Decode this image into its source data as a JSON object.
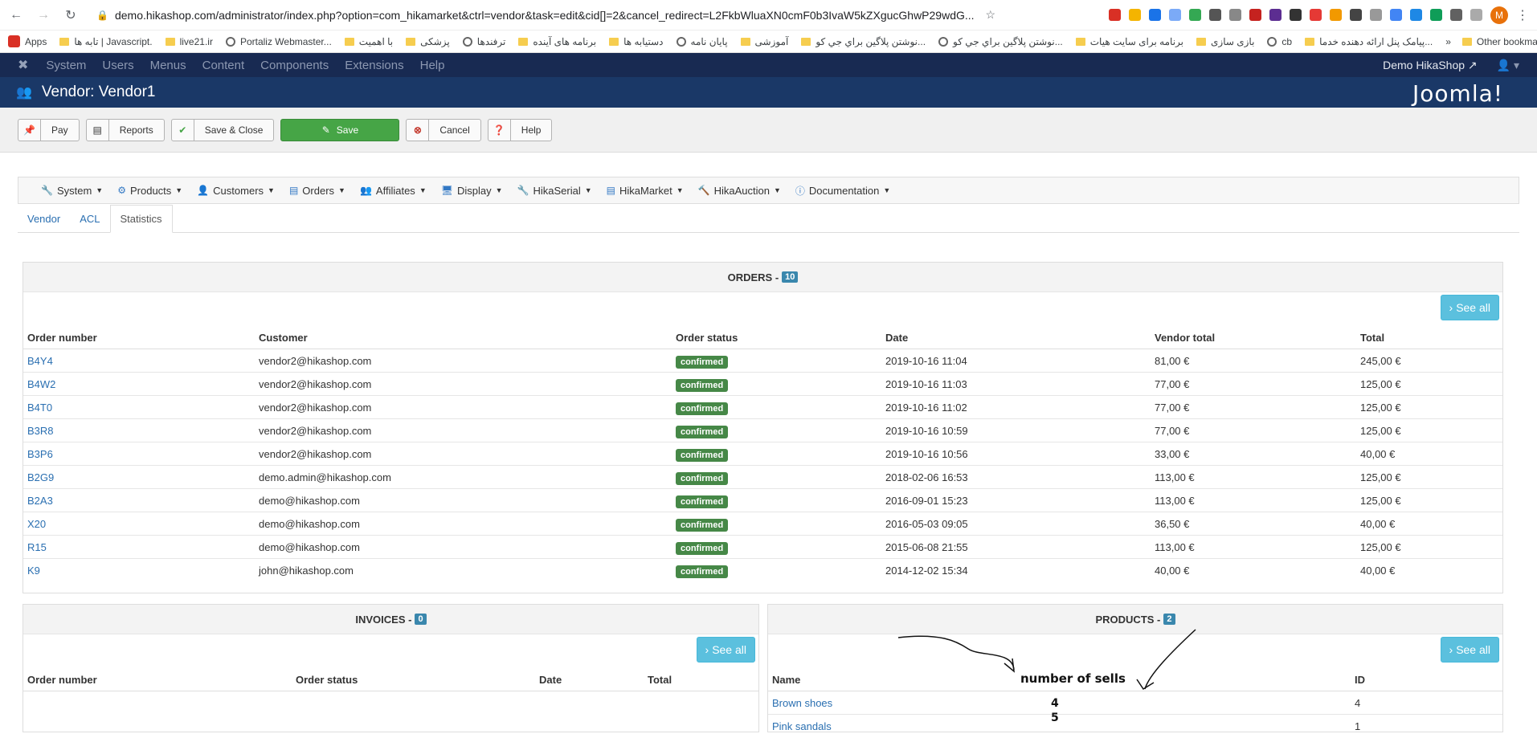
{
  "browser": {
    "url": "demo.hikashop.com/administrator/index.php?option=com_hikamarket&ctrl=vendor&task=edit&cid[]=2&cancel_redirect=L2FkbWluaXN0cmF0b3IvaW5kZXgucGhwP29wdG...",
    "avatar_letter": "M",
    "bookmarks": [
      "Apps",
      "تابه ها | Javascript.",
      "live21.ir",
      "Portaliz Webmaster...",
      "با اهمیت",
      "پزشکی",
      "ترفندها",
      "برنامه های آینده",
      "دستیابه ها",
      "پایان نامه",
      "آموزشی",
      "نوشتن پلاگین براي جي کو...",
      "نوشتن پلاگین براي جي کو...",
      "برنامه براى سايت هيات",
      "بازی سازی",
      "cb",
      "پیامک پنل ارائه دهنده خدما..."
    ],
    "other_bookmarks": "Other bookmarks"
  },
  "admin_menu": {
    "items": [
      "System",
      "Users",
      "Menus",
      "Content",
      "Components",
      "Extensions",
      "Help"
    ],
    "site_link": "Demo HikaShop"
  },
  "title": "Vendor: Vendor1",
  "brand": "Joomla!",
  "toolbar": {
    "pay": "Pay",
    "reports": "Reports",
    "save_close": "Save & Close",
    "save": "Save",
    "cancel": "Cancel",
    "help": "Help"
  },
  "hika_menu": [
    "System",
    "Products",
    "Customers",
    "Orders",
    "Affiliates",
    "Display",
    "HikaSerial",
    "HikaMarket",
    "HikaAuction",
    "Documentation"
  ],
  "tabs": [
    "Vendor",
    "ACL",
    "Statistics"
  ],
  "orders": {
    "title": "ORDERS -",
    "count": "10",
    "see_all": "See all",
    "headers": [
      "Order number",
      "Customer",
      "Order status",
      "Date",
      "Vendor total",
      "Total"
    ],
    "rows": [
      [
        "B4Y4",
        "vendor2@hikashop.com",
        "confirmed",
        "2019-10-16 11:04",
        "81,00 €",
        "245,00 €"
      ],
      [
        "B4W2",
        "vendor2@hikashop.com",
        "confirmed",
        "2019-10-16 11:03",
        "77,00 €",
        "125,00 €"
      ],
      [
        "B4T0",
        "vendor2@hikashop.com",
        "confirmed",
        "2019-10-16 11:02",
        "77,00 €",
        "125,00 €"
      ],
      [
        "B3R8",
        "vendor2@hikashop.com",
        "confirmed",
        "2019-10-16 10:59",
        "77,00 €",
        "125,00 €"
      ],
      [
        "B3P6",
        "vendor2@hikashop.com",
        "confirmed",
        "2019-10-16 10:56",
        "33,00 €",
        "40,00 €"
      ],
      [
        "B2G9",
        "demo.admin@hikashop.com",
        "confirmed",
        "2018-02-06 16:53",
        "113,00 €",
        "125,00 €"
      ],
      [
        "B2A3",
        "demo@hikashop.com",
        "confirmed",
        "2016-09-01 15:23",
        "113,00 €",
        "125,00 €"
      ],
      [
        "X20",
        "demo@hikashop.com",
        "confirmed",
        "2016-05-03 09:05",
        "36,50 €",
        "40,00 €"
      ],
      [
        "R15",
        "demo@hikashop.com",
        "confirmed",
        "2015-06-08 21:55",
        "113,00 €",
        "125,00 €"
      ],
      [
        "K9",
        "john@hikashop.com",
        "confirmed",
        "2014-12-02 15:34",
        "40,00 €",
        "40,00 €"
      ]
    ]
  },
  "invoices": {
    "title": "INVOICES -",
    "count": "0",
    "see_all": "See all",
    "headers": [
      "Order number",
      "Order status",
      "Date",
      "Total"
    ]
  },
  "products": {
    "title": "PRODUCTS -",
    "count": "2",
    "see_all": "See all",
    "headers": [
      "Name",
      "ID"
    ],
    "rows": [
      [
        "Brown shoes",
        "4"
      ],
      [
        "Pink sandals",
        "1"
      ]
    ]
  },
  "annotation": {
    "label": "number of sells",
    "values": [
      "4",
      "5"
    ]
  }
}
